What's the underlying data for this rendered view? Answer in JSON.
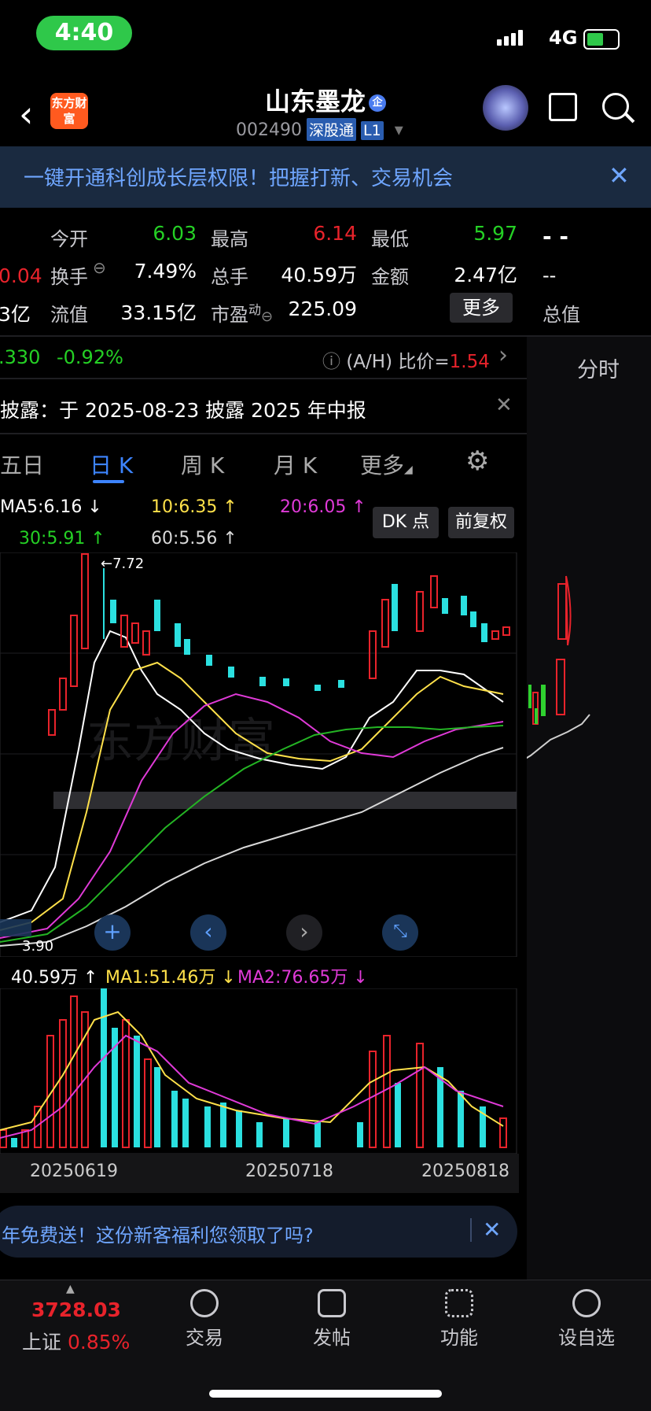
{
  "status": {
    "time": "4:40",
    "network": "4G"
  },
  "header": {
    "logo_text": "东方财富",
    "title": "山东墨龙",
    "badge": "企",
    "code": "002490",
    "tag1": "深股通",
    "tag2": "L1"
  },
  "banner": {
    "text": "一键开通科创成长层权限！把握打新、交易机会"
  },
  "quote": {
    "left_partial_1": "0.04",
    "left_partial_2": "3亿",
    "open_label": "今开",
    "open_value": "6.03",
    "high_label": "最高",
    "high_value": "6.14",
    "low_label": "最低",
    "low_value": "5.97",
    "turnover_label": "换手",
    "turnover_value": "7.49%",
    "volume_label": "总手",
    "volume_value": "40.59万",
    "amount_label": "金额",
    "amount_value": "2.47亿",
    "float_label": "流值",
    "float_value": "33.15亿",
    "pe_label": "市盈",
    "pe_sup": "动",
    "pe_value": "225.09",
    "more_label": "更多",
    "right_dash_1": "- -",
    "right_dash_2": "--",
    "right_label": "总值"
  },
  "hk": {
    "price": ".330",
    "change": "-0.92%",
    "ratio_label": "(A/H) 比价=",
    "ratio_value": "1.54"
  },
  "notice": {
    "text": "披露：于 2025-08-23 披露 2025 年中报"
  },
  "right_panel": {
    "tab": "分时"
  },
  "ktabs": [
    "五日",
    "日 K",
    "周 K",
    "月 K",
    "更多"
  ],
  "buttons": {
    "dk": "DK 点",
    "fq": "前复权"
  },
  "ma": {
    "ma5": "MA5:6.16 ↓",
    "ma10": "10:6.35 ↑",
    "ma20": "20:6.05 ↑",
    "ma30": "30:5.91 ↑",
    "ma60": "60:5.56 ↑"
  },
  "chart_labels": {
    "high_mark": "←7.72",
    "low_mark": "3.90"
  },
  "volume_legend": {
    "vol": "40.59万 ↑",
    "ma1": "MA1:51.46万 ↓",
    "ma2": "MA2:76.65万 ↓"
  },
  "chart_data": {
    "type": "candlestick",
    "dates": [
      "20250619",
      "20250718",
      "20250818"
    ],
    "price_high": 7.72,
    "price_low": 3.9,
    "colors": {
      "up": "#e8232b",
      "down": "#2be0e0",
      "ma5": "#ffffff",
      "ma10": "#ffe14a",
      "ma20": "#e03ad8",
      "ma30": "#24b424",
      "ma60": "#d9d9d9"
    }
  },
  "promo": {
    "text": "年免费送！这份新客福利您领取了吗?"
  },
  "bottom_nav": {
    "index_value": "3728.03",
    "index_name": "上证",
    "index_change": "0.85%",
    "trade": "交易",
    "post": "发帖",
    "func": "功能",
    "watch": "设自选"
  }
}
